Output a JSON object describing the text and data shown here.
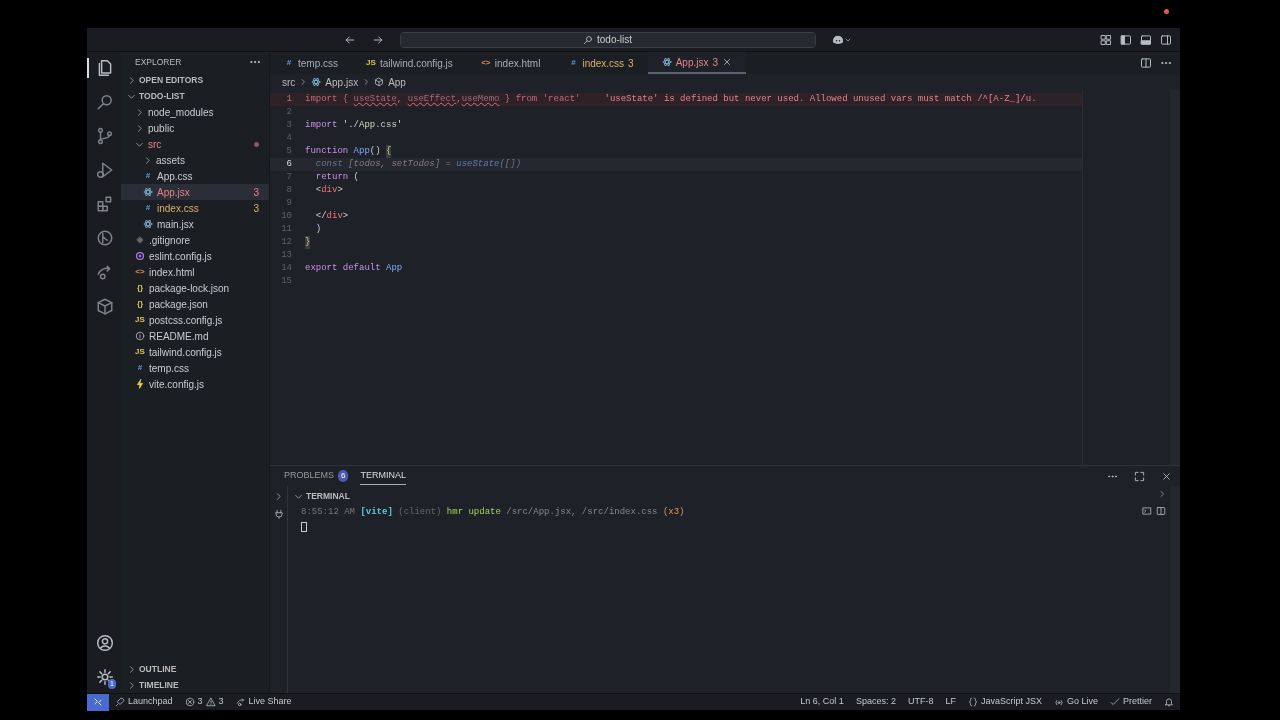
{
  "window": {
    "title": "todo-list"
  },
  "activity_bar": {
    "items": [
      {
        "kind": "files",
        "selected": true
      },
      {
        "kind": "search",
        "selected": false
      },
      {
        "kind": "source-control",
        "selected": false
      },
      {
        "kind": "run",
        "selected": false
      },
      {
        "kind": "extensions",
        "selected": false
      },
      {
        "kind": "timeline",
        "selected": false
      },
      {
        "kind": "live-share",
        "selected": false
      },
      {
        "kind": "box",
        "selected": false
      }
    ],
    "settings_badge": "1"
  },
  "sidebar": {
    "title": "EXPLORER",
    "open_editors": {
      "label": "OPEN EDITORS",
      "expanded": false
    },
    "project": {
      "label": "TODO-LIST",
      "expanded": true,
      "children": [
        {
          "label": "node_modules",
          "kind": "folder",
          "expanded": false
        },
        {
          "label": "public",
          "kind": "folder",
          "expanded": false
        },
        {
          "label": "src",
          "kind": "folder",
          "expanded": true,
          "has_errors": true,
          "children": [
            {
              "label": "assets",
              "kind": "folder",
              "expanded": false
            },
            {
              "label": "App.css",
              "kind": "css",
              "glyph": "#"
            },
            {
              "label": "App.jsx",
              "kind": "react",
              "badge": "3",
              "has_errors": true,
              "selected": true
            },
            {
              "label": "index.css",
              "kind": "css",
              "glyph": "#",
              "badge": "3",
              "has_warnings": true
            },
            {
              "label": "main.jsx",
              "kind": "react"
            }
          ]
        },
        {
          "label": ".gitignore",
          "kind": "git"
        },
        {
          "label": "eslint.config.js",
          "kind": "eslint"
        },
        {
          "label": "index.html",
          "kind": "html",
          "glyph": "<>"
        },
        {
          "label": "package-lock.json",
          "kind": "json",
          "glyph": "{}"
        },
        {
          "label": "package.json",
          "kind": "json",
          "glyph": "{}"
        },
        {
          "label": "postcss.config.js",
          "kind": "js",
          "glyph": "JS"
        },
        {
          "label": "README.md",
          "kind": "info"
        },
        {
          "label": "tailwind.config.js",
          "kind": "js",
          "glyph": "JS"
        },
        {
          "label": "temp.css",
          "kind": "css",
          "glyph": "#"
        },
        {
          "label": "vite.config.js",
          "kind": "vite"
        }
      ]
    },
    "bottom_sections": [
      {
        "label": "OUTLINE",
        "expanded": false
      },
      {
        "label": "TIMELINE",
        "expanded": false
      }
    ]
  },
  "tabs": [
    {
      "label": "temp.css",
      "kind": "css",
      "glyph": "#",
      "selected": false
    },
    {
      "label": "tailwind.config.js",
      "kind": "js",
      "glyph": "JS",
      "selected": false
    },
    {
      "label": "index.html",
      "kind": "html",
      "glyph": "<>",
      "selected": false
    },
    {
      "label": "index.css",
      "kind": "css",
      "glyph": "#",
      "badge": "3",
      "has_warnings": true,
      "selected": false
    },
    {
      "label": "App.jsx",
      "kind": "react",
      "badge": "3",
      "has_errors": true,
      "selected": true
    }
  ],
  "breadcrumb": [
    {
      "label": "src"
    },
    {
      "label": "App.jsx",
      "kind": "react"
    },
    {
      "label": "App",
      "kind": "symbol"
    }
  ],
  "editor": {
    "lines": [
      {
        "number": "1",
        "error": true,
        "current": false,
        "diagnostic": "'useState' is defined but never used. Allowed unused vars must match /^[A-Z_]/u.",
        "tokens": [
          {
            "text": "import",
            "kind": "kw"
          },
          {
            "text": " { ",
            "kind": "plain"
          },
          {
            "text": "useState",
            "kind": "unused"
          },
          {
            "text": ", ",
            "kind": "plain"
          },
          {
            "text": "useEffect",
            "kind": "unused"
          },
          {
            "text": ",",
            "kind": "plain"
          },
          {
            "text": "useMemo",
            "kind": "unused"
          },
          {
            "text": " } ",
            "kind": "plain"
          },
          {
            "text": "from",
            "kind": "kw"
          },
          {
            "text": " 'react'",
            "kind": "str"
          }
        ]
      },
      {
        "number": "2",
        "error": false,
        "current": false
      },
      {
        "number": "3",
        "error": false,
        "current": false,
        "tokens": [
          {
            "text": "import",
            "kind": "kw"
          },
          {
            "text": " './App.css'",
            "kind": "str"
          }
        ]
      },
      {
        "number": "4",
        "error": false,
        "current": false
      },
      {
        "number": "5",
        "error": false,
        "current": false,
        "tokens": [
          {
            "text": "function",
            "kind": "kw"
          },
          {
            "text": " App",
            "kind": "fn"
          },
          {
            "text": "() ",
            "kind": "plain"
          },
          {
            "text": "{",
            "kind": "bracket"
          }
        ]
      },
      {
        "number": "6",
        "error": false,
        "current": true,
        "tokens": [
          {
            "text": "  const",
            "kind": "dim"
          },
          {
            "text": " [todos, setTodos] ",
            "kind": "dimvar"
          },
          {
            "text": "= ",
            "kind": "dim"
          },
          {
            "text": "useState",
            "kind": "dimfn"
          },
          {
            "text": "([])",
            "kind": "dim"
          }
        ]
      },
      {
        "number": "7",
        "error": false,
        "current": false,
        "tokens": [
          {
            "text": "  return",
            "kind": "kw"
          },
          {
            "text": " (",
            "kind": "plain"
          }
        ]
      },
      {
        "number": "8",
        "error": false,
        "current": false,
        "tokens": [
          {
            "text": "  <",
            "kind": "plain"
          },
          {
            "text": "div",
            "kind": "tag"
          },
          {
            "text": ">",
            "kind": "plain"
          }
        ]
      },
      {
        "number": "9",
        "error": false,
        "current": false
      },
      {
        "number": "10",
        "error": false,
        "current": false,
        "tokens": [
          {
            "text": "  </",
            "kind": "plain"
          },
          {
            "text": "div",
            "kind": "tag"
          },
          {
            "text": ">",
            "kind": "plain"
          }
        ]
      },
      {
        "number": "11",
        "error": false,
        "current": false,
        "tokens": [
          {
            "text": "  )",
            "kind": "plain"
          }
        ]
      },
      {
        "number": "12",
        "error": false,
        "current": false,
        "tokens": [
          {
            "text": "}",
            "kind": "bracket"
          }
        ]
      },
      {
        "number": "13",
        "error": false,
        "current": false
      },
      {
        "number": "14",
        "error": false,
        "current": false,
        "tokens": [
          {
            "text": "export",
            "kind": "kw"
          },
          {
            "text": " default",
            "kind": "kw"
          },
          {
            "text": " App",
            "kind": "fn"
          }
        ]
      },
      {
        "number": "15",
        "error": false,
        "current": false
      }
    ]
  },
  "panel": {
    "tabs": [
      {
        "label": "PROBLEMS",
        "badge": "6",
        "selected": false
      },
      {
        "label": "TERMINAL",
        "selected": true
      }
    ],
    "terminal_header": {
      "label": "TERMINAL",
      "expanded": true
    },
    "terminal_lines": [
      [
        {
          "text": "8:55:12 AM",
          "kind": "time"
        },
        {
          "text": " [vite]",
          "kind": "tool"
        },
        {
          "text": " (client)",
          "kind": "dim"
        },
        {
          "text": " hmr update",
          "kind": "ok"
        },
        {
          "text": " /src/App.jsx, /src/index.css",
          "kind": "path"
        },
        {
          "text": " (x3)",
          "kind": "count"
        }
      ]
    ]
  },
  "status_bar": {
    "left": [
      {
        "kind": "remote"
      },
      {
        "kind": "launchpad",
        "label": "Launchpad"
      },
      {
        "kind": "problems",
        "errors": "3",
        "warnings": "3"
      },
      {
        "kind": "live-share",
        "label": "Live Share"
      }
    ],
    "right": [
      {
        "kind": "text",
        "label": "Ln 6, Col 1"
      },
      {
        "kind": "text",
        "label": "Spaces: 2"
      },
      {
        "kind": "text",
        "label": "UTF-8"
      },
      {
        "kind": "text",
        "label": "LF"
      },
      {
        "kind": "language",
        "label": "JavaScript JSX"
      },
      {
        "kind": "go-live",
        "label": "Go Live"
      },
      {
        "kind": "prettier",
        "label": "Prettier"
      },
      {
        "kind": "bell"
      }
    ]
  }
}
